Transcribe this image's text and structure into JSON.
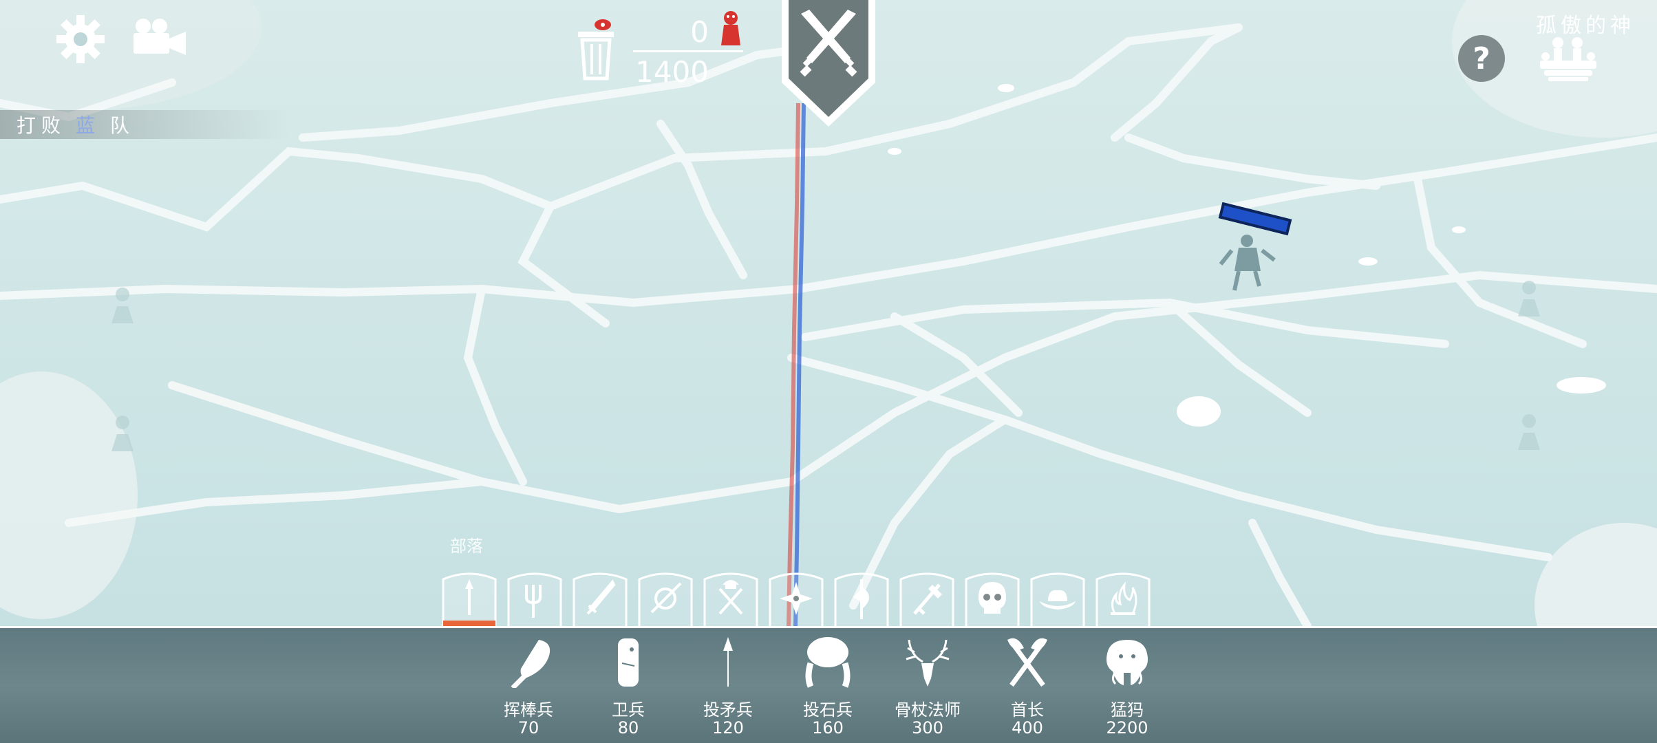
{
  "hud": {
    "objective_prefix": "打败",
    "objective_team": "蓝",
    "objective_suffix": "队",
    "units_used": "0",
    "units_max": "1400",
    "map_name": "孤傲的神"
  },
  "faction": {
    "label": "部落",
    "tabs": [
      {
        "icon": "arrow-icon",
        "active": true
      },
      {
        "icon": "trident-icon"
      },
      {
        "icon": "sword-icon"
      },
      {
        "icon": "shield-spear-icon"
      },
      {
        "icon": "viking-axes-icon"
      },
      {
        "icon": "shuriken-icon"
      },
      {
        "icon": "halberd-icon"
      },
      {
        "icon": "crossed-swords-icon"
      },
      {
        "icon": "skull-icon"
      },
      {
        "icon": "cowboy-hat-icon"
      },
      {
        "icon": "flame-icon"
      }
    ]
  },
  "units": [
    {
      "name": "挥棒兵",
      "cost": "70",
      "icon": "club-icon"
    },
    {
      "name": "卫兵",
      "cost": "80",
      "icon": "guard-shield-icon"
    },
    {
      "name": "投矛兵",
      "cost": "120",
      "icon": "spear-icon"
    },
    {
      "name": "投石兵",
      "cost": "160",
      "icon": "stone-thrower-icon"
    },
    {
      "name": "骨杖法师",
      "cost": "300",
      "icon": "antler-skull-icon"
    },
    {
      "name": "首长",
      "cost": "400",
      "icon": "crossed-axes-icon"
    },
    {
      "name": "猛犸",
      "cost": "2200",
      "icon": "mammoth-icon"
    }
  ],
  "colors": {
    "red_team": "#d8342f",
    "blue_team": "#2a5ed6",
    "active_tab": "#e8663a",
    "panel": "#647e84",
    "ground": "#cfe4e4"
  }
}
